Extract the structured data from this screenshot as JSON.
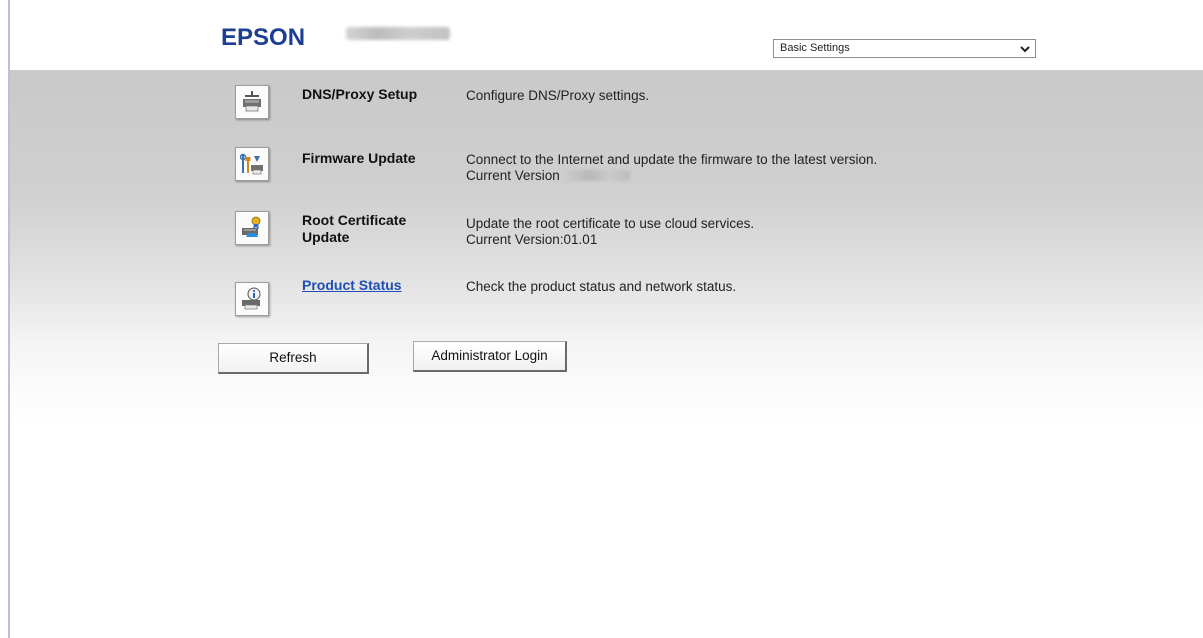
{
  "header": {
    "logo": "EPSON",
    "settings_select": {
      "selected": "Basic Settings"
    }
  },
  "rows": [
    {
      "title": "DNS/Proxy Setup",
      "desc_line1": "Configure DNS/Proxy settings.",
      "icon": "printer-icon"
    },
    {
      "title": "Firmware Update",
      "desc_line1": "Connect to the Internet and update the firmware to the latest version.",
      "desc_line2": "Current Version",
      "icon": "firmware-tools-icon"
    },
    {
      "title_line1": "Root Certificate",
      "title_line2": "Update",
      "desc_line1": "Update the root certificate to use cloud services.",
      "desc_line2": "Current Version:01.01",
      "icon": "certificate-printer-icon"
    },
    {
      "title": "Product Status",
      "desc_line1": "Check the product status and network status.",
      "icon": "info-printer-icon"
    }
  ],
  "buttons": {
    "refresh": "Refresh",
    "admin_login": "Administrator Login"
  },
  "colors": {
    "brand": "#1d3f93",
    "link": "#1f4fb4"
  }
}
